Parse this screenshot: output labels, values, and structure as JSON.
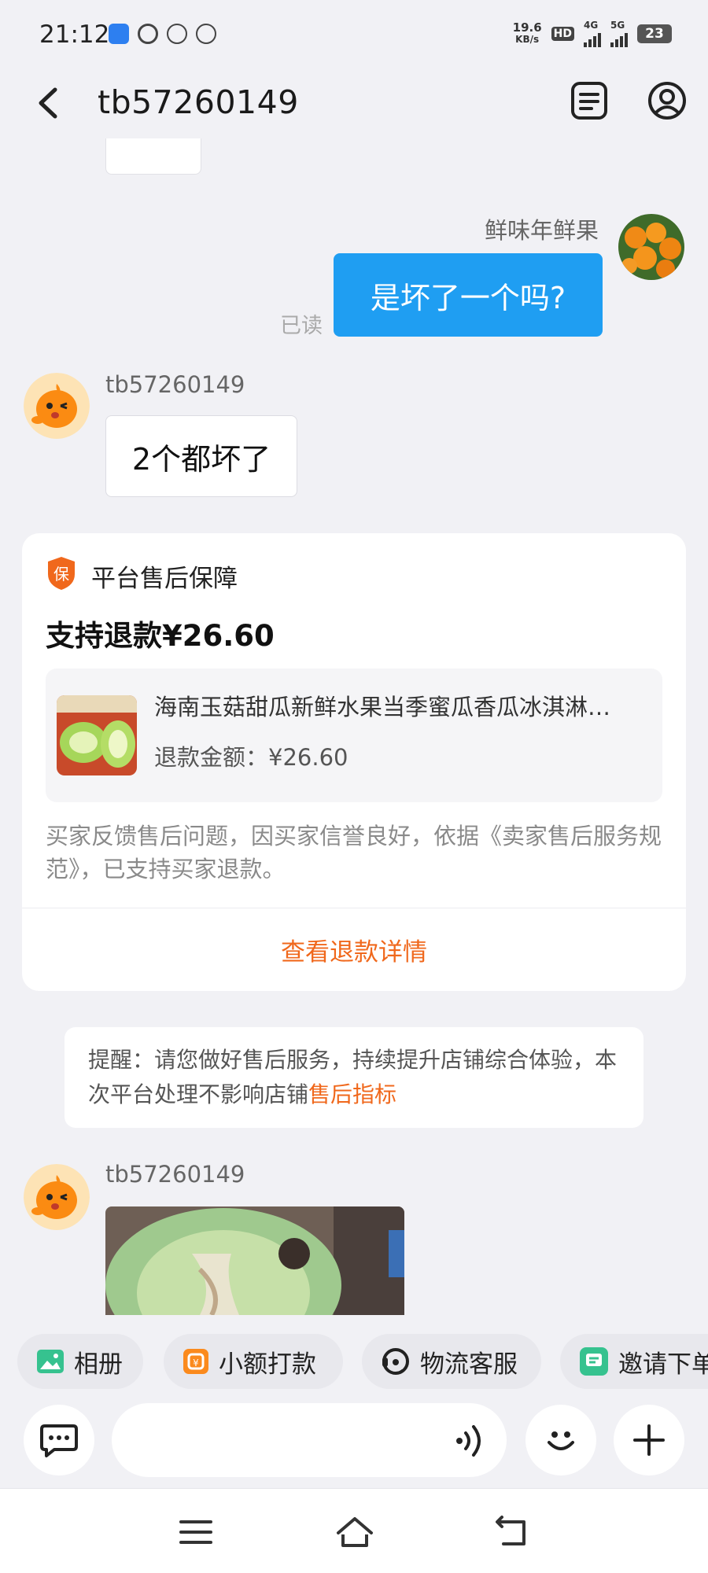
{
  "status_bar": {
    "time": "21:12",
    "net_speed_value": "19.6",
    "net_speed_unit": "KB/s",
    "hd_label": "HD",
    "sim1_label": "4G",
    "sim2_label": "5G",
    "battery": "23"
  },
  "header": {
    "title": "tb57260149"
  },
  "chat": {
    "messages": [
      {
        "sender": "鲜味年鲜果",
        "text": "是坏了一个吗?",
        "status": "已读"
      },
      {
        "sender": "tb57260149",
        "text": "2个都坏了"
      },
      {
        "sender": "tb57260149"
      }
    ]
  },
  "refund_card": {
    "badge": "保",
    "tag": "平台售后保障",
    "amount_text": "支持退款¥26.60",
    "product_title": "海南玉菇甜瓜新鲜水果当季蜜瓜香瓜冰淇淋…",
    "product_refund": "退款金额：¥26.60",
    "description": "买家反馈售后问题，因买家信誉良好，依据《卖家售后服务规范》，已支持买家退款。",
    "link": "查看退款详情"
  },
  "reminder": {
    "text": "提醒：请您做好售后服务，持续提升店铺综合体验，本次平台处理不影响店铺",
    "link": "售后指标"
  },
  "quick_actions": {
    "album": "相册",
    "small_payment": "小额打款",
    "logistics_service": "物流客服",
    "invite_order": "邀请下单"
  },
  "input": {
    "placeholder": ""
  },
  "colors": {
    "accent_blue": "#1f9ef2",
    "accent_orange": "#f0681c",
    "background": "#f1f1f5"
  }
}
